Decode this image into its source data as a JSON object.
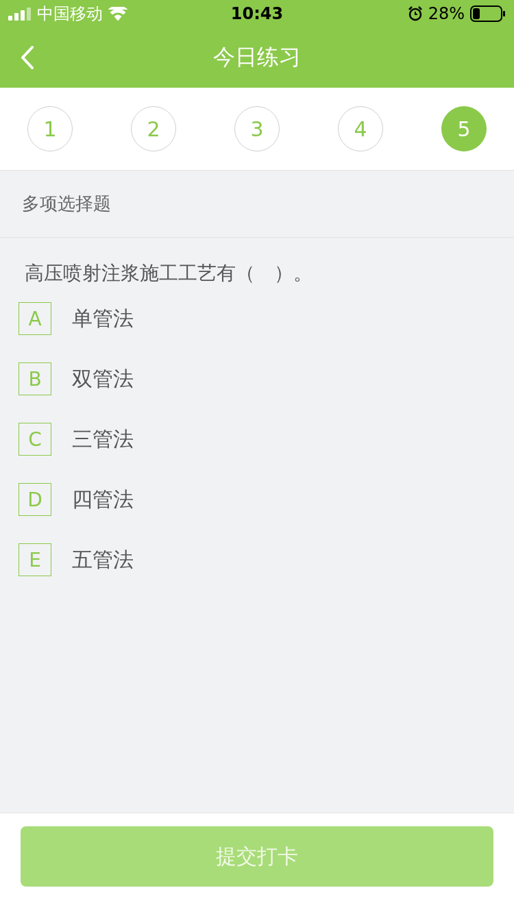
{
  "status_bar": {
    "carrier": "中国移动",
    "time": "10:43",
    "battery": "28%"
  },
  "nav": {
    "title": "今日练习"
  },
  "steps": [
    {
      "label": "1",
      "selected": false
    },
    {
      "label": "2",
      "selected": false
    },
    {
      "label": "3",
      "selected": false
    },
    {
      "label": "4",
      "selected": false
    },
    {
      "label": "5",
      "selected": true
    }
  ],
  "section": {
    "title": "多项选择题"
  },
  "question": {
    "text": "高压喷射注浆施工工艺有（　）。",
    "options": [
      {
        "letter": "A",
        "text": "单管法",
        "selected": false
      },
      {
        "letter": "B",
        "text": "双管法",
        "selected": false
      },
      {
        "letter": "C",
        "text": "三管法",
        "selected": false
      },
      {
        "letter": "D",
        "text": "四管法",
        "selected": false
      },
      {
        "letter": "E",
        "text": "五管法",
        "selected": false
      }
    ]
  },
  "submit": {
    "label": "提交打卡",
    "disabled": true
  }
}
